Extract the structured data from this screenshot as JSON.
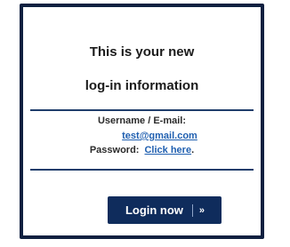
{
  "card": {
    "heading_line1": "This is your new",
    "heading_line2": "log-in information",
    "username_label": "Username / E-mail:",
    "email": "test@gmail.com",
    "password_label": "Password:",
    "password_link": "Click here",
    "password_period": "."
  },
  "button": {
    "label": "Login now",
    "icon": "double-chevron-right-icon",
    "chevron": "»"
  },
  "colors": {
    "frame": "#0f2040",
    "divider": "#1f3d6b",
    "link": "#1f5fb0",
    "button_bg": "#0f2c5c"
  }
}
